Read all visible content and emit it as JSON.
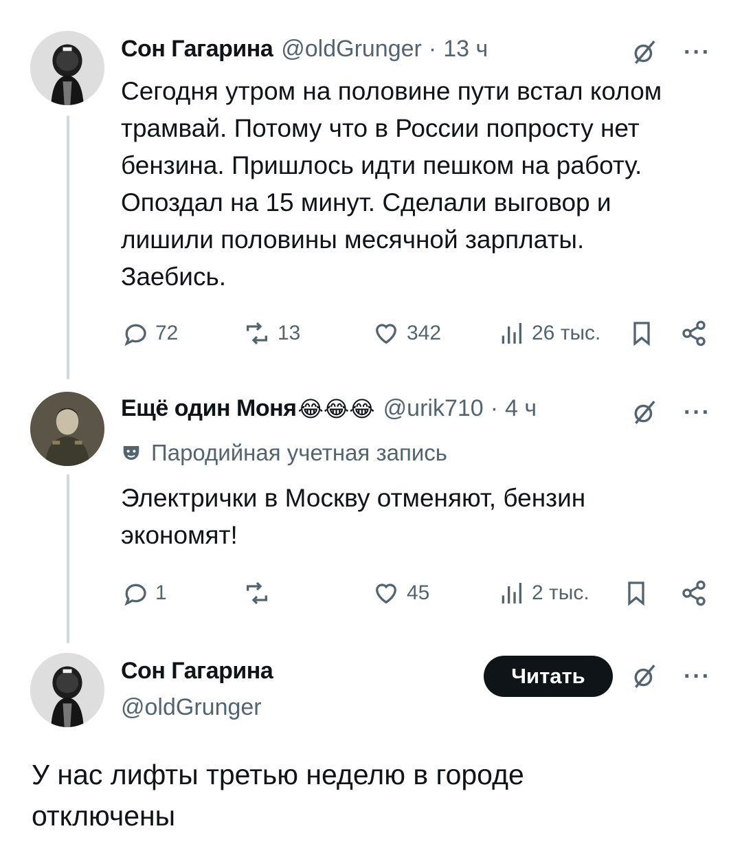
{
  "tweets": [
    {
      "name": "Сон Гагарина",
      "handle": "@oldGrunger",
      "separator": "·",
      "time": "13 ч",
      "text_lines": [
        "Сегодня утром на половине пути встал колом",
        "трамвай. Потому что в России попросту нет",
        "бензина. Пришлось идти пешком на работу.",
        "Опоздал на 15 минут. Сделали выговор и",
        "лишили половины месячной зарплаты.",
        "Заебись."
      ],
      "actions": {
        "replies": "72",
        "reposts": "13",
        "likes": "342",
        "views": "26 тыс."
      }
    },
    {
      "name": "Ещё один Моня",
      "emojis": "😂😂😂",
      "handle": "@urik710",
      "separator": "·",
      "time": "4 ч",
      "parody_label": "Пародийная учетная запись",
      "text_lines": [
        "Электрички в Москву отменяют, бензин",
        "экономят!"
      ],
      "actions": {
        "replies": "1",
        "reposts": "",
        "likes": "45",
        "views": "2 тыс."
      }
    },
    {
      "name": "Сон Гагарина",
      "handle": "@oldGrunger",
      "follow_label": "Читать",
      "text_lines": [
        "У нас лифты третью неделю в городе",
        "отключены"
      ]
    }
  ],
  "icons": {
    "grok": "grok-slash-icon",
    "more": "more-dots-icon",
    "reply": "reply-bubble-icon",
    "repost": "repost-icon",
    "like": "heart-icon",
    "views": "views-bars-icon",
    "bookmark": "bookmark-icon",
    "share": "share-icon",
    "parody": "mask-icon"
  },
  "colors": {
    "text": "#0f1419",
    "muted": "#536471",
    "thread_line": "#cfd9de",
    "button_bg": "#0f1419"
  }
}
